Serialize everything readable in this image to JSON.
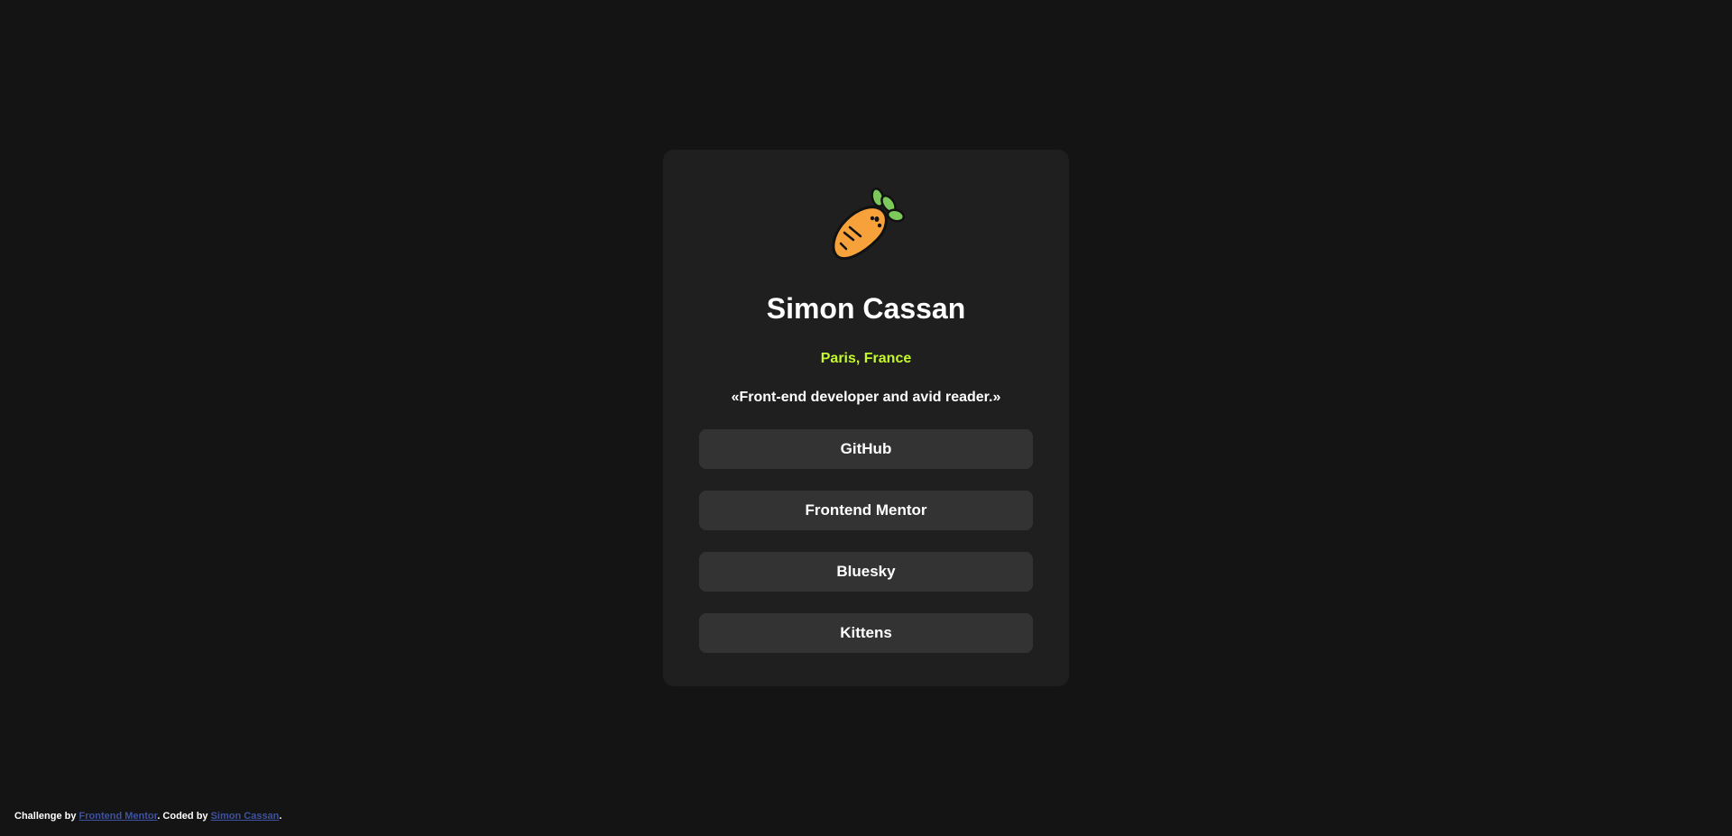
{
  "profile": {
    "avatar_icon": "carrot-icon",
    "name": "Simon Cassan",
    "location": "Paris, France",
    "bio": "«Front-end developer and avid reader.»"
  },
  "links": [
    {
      "label": "GitHub"
    },
    {
      "label": "Frontend Mentor"
    },
    {
      "label": "Bluesky"
    },
    {
      "label": "Kittens"
    }
  ],
  "attribution": {
    "prefix": "Challenge by ",
    "challenge_link": "Frontend Mentor",
    "middle": ". Coded by ",
    "author_link": "Simon Cassan",
    "suffix": "."
  },
  "colors": {
    "background": "#141414",
    "card": "#1f1f1f",
    "button": "#333333",
    "accent": "#c4f82a",
    "link": "#3e52a3"
  }
}
